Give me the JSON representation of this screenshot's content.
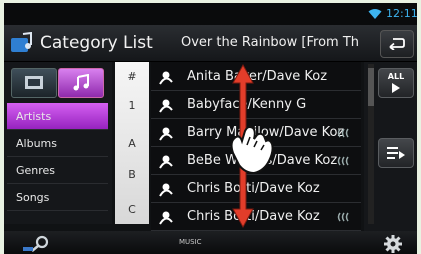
{
  "status": {
    "time": "12:11",
    "wifi_icon": "wifi-icon"
  },
  "header": {
    "title": "Category List",
    "now_playing": "Over the Rainbow [From The Wizard of Oz]",
    "back_icon": "back-arrow-icon"
  },
  "source_tabs": [
    {
      "name": "video",
      "icon": "film-icon"
    },
    {
      "name": "music",
      "icon": "music-note-icon",
      "selected": true
    }
  ],
  "categories": [
    {
      "label": "Artists",
      "selected": true
    },
    {
      "label": "Albums"
    },
    {
      "label": "Genres"
    },
    {
      "label": "Songs"
    }
  ],
  "index": [
    "#",
    "1",
    "A",
    "B",
    "C"
  ],
  "list": [
    {
      "label": "Anita Baker/Dave Koz",
      "wave": false
    },
    {
      "label": "Babyface/Kenny G",
      "wave": false
    },
    {
      "label": "Barry Manilow/Dave Koz",
      "wave": true
    },
    {
      "label": "BeBe Winans/Dave Koz",
      "wave": true
    },
    {
      "label": "Chris Botti/Dave Koz",
      "wave": false
    },
    {
      "label": "Chris Botti/Dave Koz",
      "wave": true
    }
  ],
  "right_buttons": {
    "all_label": "ALL",
    "play_icon": "play-icon",
    "queue_icon": "queue-list-icon"
  },
  "footer": {
    "label": "MUSIC",
    "search_icon": "search-icon",
    "settings_icon": "gear-icon"
  },
  "gesture": {
    "icon": "flick-hand-icon",
    "direction": "vertical"
  },
  "colors": {
    "accent": "#b040d8",
    "clock": "#3db4f0"
  }
}
